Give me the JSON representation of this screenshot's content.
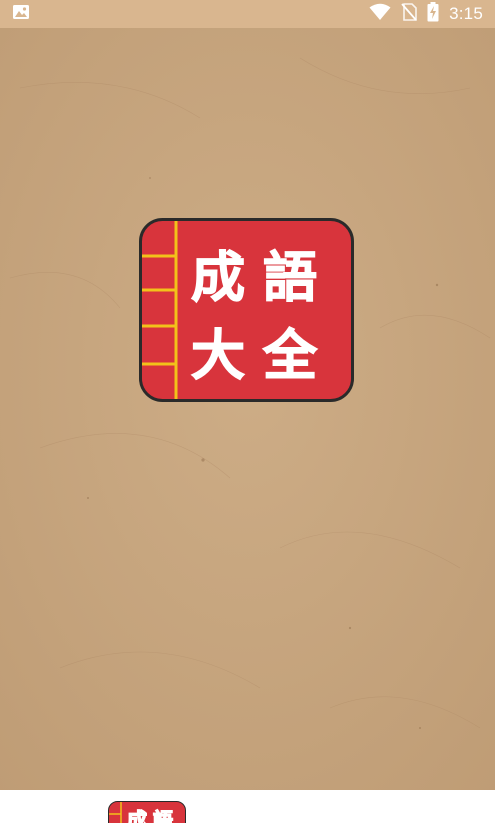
{
  "status_bar": {
    "time": "3:15",
    "icons": [
      "image-notification-icon",
      "wifi-icon",
      "no-sim-icon",
      "battery-charging-icon"
    ]
  },
  "logo": {
    "line1": "成語",
    "line2": "大全",
    "chars": [
      "成",
      "語",
      "大",
      "全"
    ],
    "colors": {
      "cover": "#d8343c",
      "border": "#2a2a2a",
      "binding_lines": "#f2c21a"
    }
  },
  "colors": {
    "status_bar": "#d9b68f",
    "paper": "#c7a57f",
    "footer": "#ffffff"
  }
}
